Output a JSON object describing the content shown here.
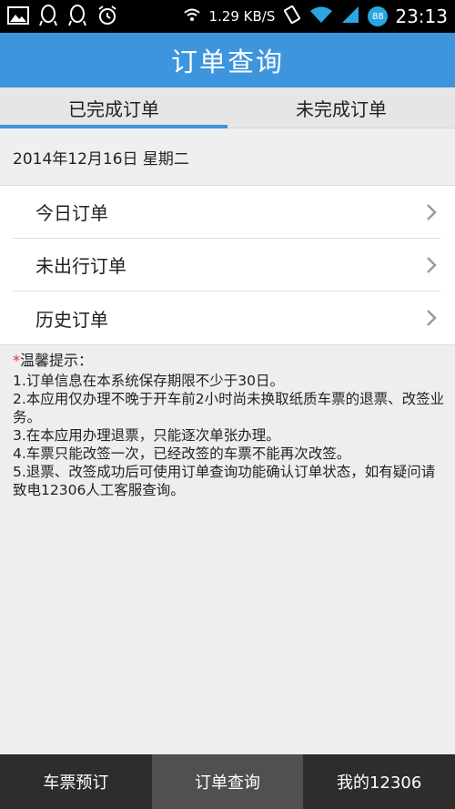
{
  "status_bar": {
    "left_icons": [
      "image-icon",
      "qq-icon",
      "qq-icon-2",
      "alarm-icon"
    ],
    "speed": "1.29 KB/S",
    "battery": "88",
    "time": "23:13"
  },
  "header": {
    "title": "订单查询"
  },
  "tabs": [
    {
      "label": "已完成订单",
      "active": true
    },
    {
      "label": "未完成订单",
      "active": false
    }
  ],
  "date": "2014年12月16日 星期二",
  "list_items": [
    {
      "label": "今日订单"
    },
    {
      "label": "未出行订单"
    },
    {
      "label": "历史订单"
    }
  ],
  "tips": {
    "asterisk": "*",
    "title": "温馨提示：",
    "lines": [
      "1.订单信息在本系统保存期限不少于30日。",
      "2.本应用仅办理不晚于开车前2小时尚未换取纸质车票的退票、改签业务。",
      "3.在本应用办理退票，只能逐次单张办理。",
      "4.车票只能改签一次，已经改签的车票不能再次改签。",
      "5.退票、改签成功后可使用订单查询功能确认订单状态，如有疑问请致电12306人工客服查询。"
    ]
  },
  "bottom_nav": [
    {
      "label": "车票预订",
      "active": false
    },
    {
      "label": "订单查询",
      "active": true
    },
    {
      "label": "我的12306",
      "active": false
    }
  ],
  "colors": {
    "accent": "#3d95de",
    "nav_bg": "#2d2d2d",
    "nav_active": "#505050"
  }
}
